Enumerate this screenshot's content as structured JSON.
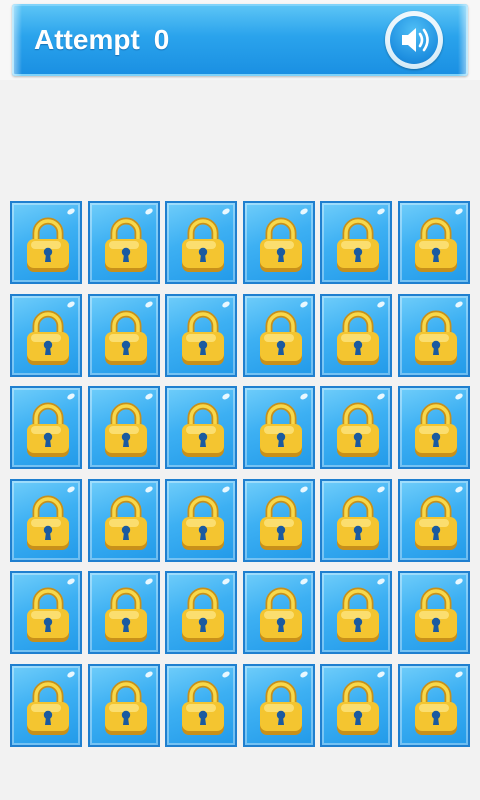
{
  "header": {
    "attempt_label": "Attempt",
    "attempt_count": "0",
    "sound_icon": "speaker-volume-icon"
  },
  "board": {
    "rows": 6,
    "columns": 6,
    "tile_state": "locked",
    "tile_icon": "padlock-icon"
  },
  "colors": {
    "header_blue": "#2aa3ec",
    "tile_blue": "#3db0f3",
    "tile_border": "#1f7fcf",
    "lock_gold": "#f4c530",
    "background": "#f2f2f2"
  }
}
